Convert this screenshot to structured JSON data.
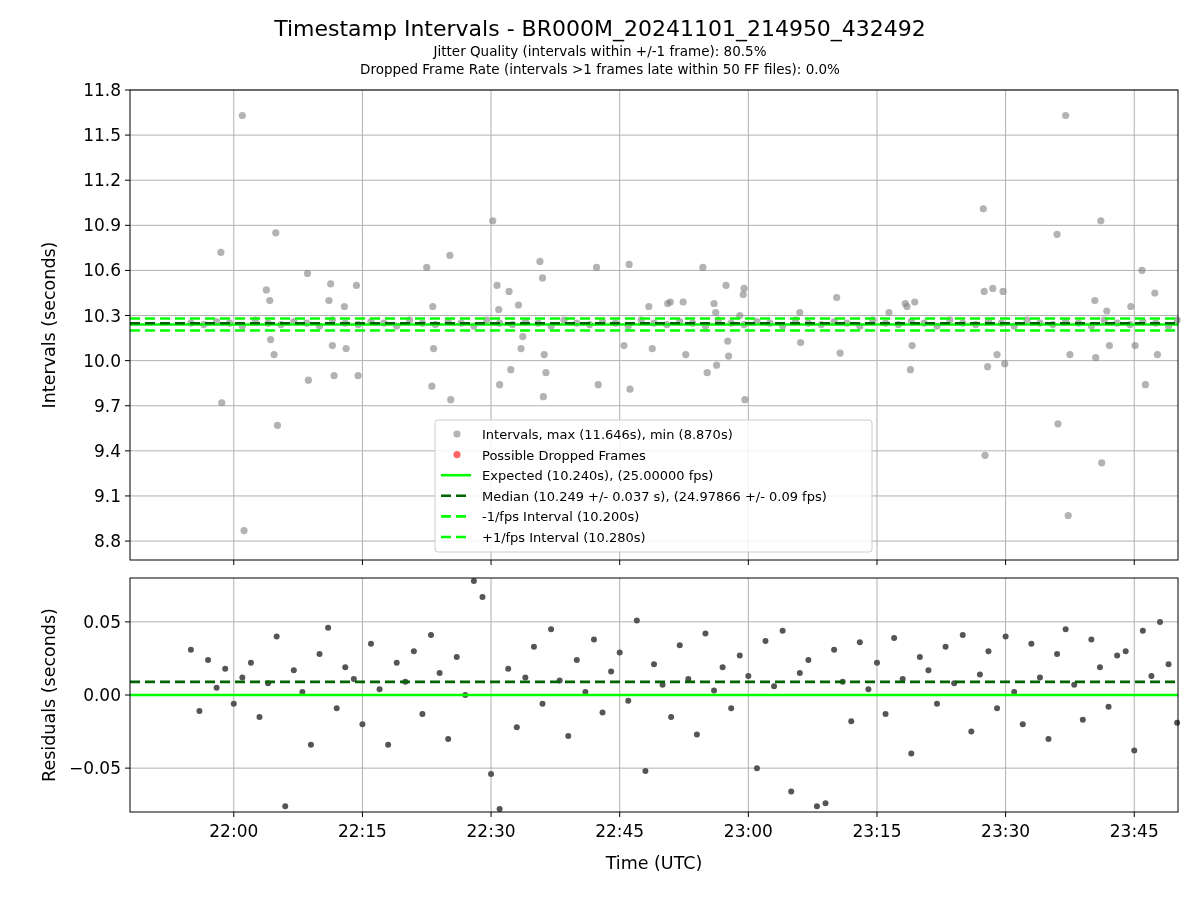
{
  "title": "Timestamp Intervals - BR000M_20241101_214950_432492",
  "subtitles": [
    "Jitter Quality (intervals within +/-1 frame): 80.5%",
    "Dropped Frame Rate (intervals >1 frames late within 50 FF files): 0.0%"
  ],
  "intervals_plot": {
    "chart_data": {
      "type": "scatter",
      "ylabel": "Intervals (seconds)",
      "xlim": [
        1307.9,
        1430.1
      ],
      "ylim": [
        8.674,
        11.8
      ],
      "yticks": [
        {
          "value": 8.8,
          "label": "8.8"
        },
        {
          "value": 9.1,
          "label": "9.1"
        },
        {
          "value": 9.4,
          "label": "9.4"
        },
        {
          "value": 9.7,
          "label": "9.7"
        },
        {
          "value": 10.0,
          "label": "10.0"
        },
        {
          "value": 10.3,
          "label": "10.3"
        },
        {
          "value": 10.6,
          "label": "10.6"
        },
        {
          "value": 10.9,
          "label": "10.9"
        },
        {
          "value": 11.2,
          "label": "11.2"
        },
        {
          "value": 11.5,
          "label": "11.5"
        },
        {
          "value": 11.8,
          "label": "11.8"
        }
      ],
      "series": [
        {
          "name": "Intervals, max (11.646s), min (8.870s)",
          "color": "#808080",
          "x": [
            1318.5,
            1318.6,
            1321.0,
            1321.2,
            1323.8,
            1324.2,
            1324.3,
            1324.7,
            1324.9,
            1325.1,
            1328.6,
            1328.7,
            1331.1,
            1331.3,
            1331.5,
            1331.7,
            1332.9,
            1333.1,
            1334.3,
            1334.5,
            1342.5,
            1343.1,
            1343.2,
            1343.3,
            1345.2,
            1345.3,
            1350.2,
            1350.7,
            1350.9,
            1351.0,
            1352.1,
            1352.3,
            1353.2,
            1353.5,
            1353.7,
            1355.7,
            1356.0,
            1356.1,
            1356.2,
            1356.4,
            1362.3,
            1362.5,
            1365.5,
            1366.1,
            1366.2,
            1368.4,
            1368.8,
            1370.6,
            1370.9,
            1372.4,
            1372.7,
            1374.7,
            1375.2,
            1376.0,
            1376.2,
            1376.3,
            1377.4,
            1377.6,
            1377.7,
            1379.0,
            1379.4,
            1379.5,
            1379.6,
            1386.0,
            1386.1,
            1390.3,
            1390.7,
            1396.4,
            1398.3,
            1398.5,
            1398.9,
            1399.1,
            1399.4,
            1407.4,
            1407.5,
            1407.6,
            1407.9,
            1408.5,
            1409.0,
            1409.7,
            1409.9,
            1416.0,
            1416.1,
            1417.0,
            1417.3,
            1417.5,
            1420.4,
            1420.5,
            1421.1,
            1421.2,
            1421.8,
            1422.1,
            1424.6,
            1425.1,
            1425.9,
            1426.3,
            1427.4,
            1427.7,
            1315,
            1316.5,
            1318,
            1319.5,
            1321,
            1322.5,
            1324,
            1325.5,
            1327,
            1328.5,
            1330,
            1331.5,
            1333,
            1334.5,
            1336,
            1337.5,
            1339,
            1340.5,
            1342,
            1343.5,
            1345,
            1346.5,
            1348,
            1349.5,
            1351,
            1352.5,
            1354,
            1355.5,
            1357,
            1358.5,
            1360,
            1361.5,
            1363,
            1364.5,
            1366,
            1367.5,
            1369,
            1370.5,
            1372,
            1373.5,
            1375,
            1376.5,
            1378,
            1379.5,
            1381,
            1382.5,
            1384,
            1385.5,
            1387,
            1388.5,
            1390,
            1391.5,
            1393,
            1394.5,
            1396,
            1397.5,
            1399,
            1400.5,
            1402,
            1403.5,
            1405,
            1406.5,
            1408,
            1409.5,
            1411,
            1412.5,
            1414,
            1415.5,
            1417,
            1418.5,
            1420,
            1421.5,
            1423,
            1424.5,
            1426,
            1427.5,
            1429,
            1430
          ],
          "values": [
            10.72,
            9.72,
            11.63,
            8.87,
            10.47,
            10.4,
            10.14,
            10.04,
            10.85,
            9.57,
            10.58,
            9.87,
            10.4,
            10.51,
            10.1,
            9.9,
            10.36,
            10.08,
            10.5,
            9.9,
            10.62,
            9.83,
            10.36,
            10.08,
            10.7,
            9.74,
            10.93,
            10.5,
            10.34,
            9.84,
            10.46,
            9.94,
            10.37,
            10.08,
            10.16,
            10.66,
            10.55,
            9.76,
            10.04,
            9.92,
            10.62,
            9.84,
            10.1,
            10.64,
            9.81,
            10.36,
            10.08,
            10.38,
            10.39,
            10.39,
            10.04,
            10.62,
            9.92,
            10.38,
            10.32,
            9.97,
            10.5,
            10.13,
            10.03,
            10.3,
            10.44,
            10.48,
            9.74,
            10.32,
            10.12,
            10.42,
            10.05,
            10.32,
            10.38,
            10.36,
            9.94,
            10.1,
            10.39,
            11.01,
            10.46,
            9.37,
            9.96,
            10.48,
            10.04,
            10.46,
            9.98,
            10.84,
            9.58,
            11.63,
            8.97,
            10.04,
            10.4,
            10.02,
            10.93,
            9.32,
            10.33,
            10.1,
            10.36,
            10.1,
            10.6,
            9.84,
            10.45,
            10.04,
            10.25,
            10.24,
            10.26,
            10.25,
            10.23,
            10.27,
            10.25,
            10.24,
            10.26,
            10.25,
            10.23,
            10.27,
            10.25,
            10.24,
            10.26,
            10.25,
            10.23,
            10.27,
            10.25,
            10.24,
            10.26,
            10.25,
            10.23,
            10.27,
            10.25,
            10.24,
            10.26,
            10.25,
            10.23,
            10.27,
            10.25,
            10.24,
            10.26,
            10.25,
            10.23,
            10.27,
            10.25,
            10.24,
            10.26,
            10.25,
            10.23,
            10.27,
            10.25,
            10.24,
            10.26,
            10.25,
            10.23,
            10.27,
            10.25,
            10.24,
            10.26,
            10.25,
            10.23,
            10.27,
            10.25,
            10.24,
            10.26,
            10.25,
            10.23,
            10.27,
            10.25,
            10.24,
            10.26,
            10.25,
            10.23,
            10.27,
            10.25,
            10.24,
            10.26,
            10.25,
            10.23,
            10.27,
            10.25,
            10.24,
            10.26,
            10.25,
            10.23,
            10.27
          ]
        },
        {
          "name": "Possible Dropped Frames",
          "color": "#ff0000"
        },
        {
          "type": "line",
          "line_style": "solid",
          "name": "Expected (10.240s), (25.00000 fps)",
          "color": "#00ff00",
          "x": [
            1307.9,
            1430.1
          ],
          "values": [
            10.24,
            10.24
          ]
        },
        {
          "type": "line",
          "line_style": "dashed",
          "name": "Median (10.249 +/- 0.037 s), (24.97866 +/- 0.09 fps)",
          "color": "#006400",
          "x": [
            1307.9,
            1430.1
          ],
          "values": [
            10.249,
            10.249
          ]
        },
        {
          "type": "line",
          "line_style": "dashed",
          "name": "-1/fps Interval (10.200s)",
          "color": "#00ff00",
          "x": [
            1307.9,
            1430.1
          ],
          "values": [
            10.2,
            10.2
          ]
        },
        {
          "type": "line",
          "line_style": "dashed",
          "name": "+1/fps Interval (10.280s)",
          "color": "#00ff00",
          "x": [
            1307.9,
            1430.1
          ],
          "values": [
            10.28,
            10.28
          ]
        }
      ],
      "grid": true,
      "legend": "lower center"
    }
  },
  "residuals_plot": {
    "chart_data": {
      "type": "scatter",
      "xlabel": "Time (UTC)",
      "ylabel": "Residuals (seconds)",
      "xlim": [
        1307.9,
        1430.1
      ],
      "ylim": [
        -0.08,
        0.08
      ],
      "xticks": [
        {
          "value": 1320,
          "label": "22:00"
        },
        {
          "value": 1335,
          "label": "22:15"
        },
        {
          "value": 1350,
          "label": "22:30"
        },
        {
          "value": 1365,
          "label": "22:45"
        },
        {
          "value": 1380,
          "label": "23:00"
        },
        {
          "value": 1395,
          "label": "23:15"
        },
        {
          "value": 1410,
          "label": "23:30"
        },
        {
          "value": 1425,
          "label": "23:45"
        }
      ],
      "yticks": [
        {
          "value": -0.05,
          "label": "−0.05"
        },
        {
          "value": 0,
          "label": "0.00"
        },
        {
          "value": 0.05,
          "label": "0.05"
        }
      ],
      "series": [
        {
          "color": "#555555",
          "x": [
            1315,
            1316,
            1317,
            1318,
            1319,
            1320,
            1321,
            1322,
            1323,
            1324,
            1325,
            1326,
            1327,
            1328,
            1329,
            1330,
            1331,
            1332,
            1333,
            1334,
            1335,
            1336,
            1337,
            1338,
            1339,
            1340,
            1341,
            1342,
            1343,
            1344,
            1345,
            1346,
            1347,
            1348,
            1349,
            1350,
            1351,
            1352,
            1353,
            1354,
            1355,
            1356,
            1357,
            1358,
            1359,
            1360,
            1361,
            1362,
            1363,
            1364,
            1365,
            1366,
            1367,
            1368,
            1369,
            1370,
            1371,
            1372,
            1373,
            1374,
            1375,
            1376,
            1377,
            1378,
            1379,
            1380,
            1381,
            1382,
            1383,
            1384,
            1385,
            1386,
            1387,
            1388,
            1389,
            1390,
            1391,
            1392,
            1393,
            1394,
            1395,
            1396,
            1397,
            1398,
            1399,
            1400,
            1401,
            1402,
            1403,
            1404,
            1405,
            1406,
            1407,
            1408,
            1409,
            1410,
            1411,
            1412,
            1413,
            1414,
            1415,
            1416,
            1417,
            1418,
            1419,
            1420,
            1421,
            1422,
            1423,
            1424,
            1425,
            1426,
            1427,
            1428,
            1429,
            1430
          ],
          "values": [
            0.031,
            -0.011,
            0.024,
            0.005,
            0.018,
            -0.006,
            0.012,
            0.022,
            -0.015,
            0.008,
            0.04,
            -0.076,
            0.017,
            0.002,
            -0.034,
            0.028,
            0.046,
            -0.009,
            0.019,
            0.011,
            -0.02,
            0.035,
            0.004,
            -0.034,
            0.022,
            0.009,
            0.03,
            -0.013,
            0.041,
            0.015,
            -0.03,
            0.026,
            0.0,
            0.078,
            0.067,
            -0.054,
            -0.078,
            0.018,
            -0.022,
            0.012,
            0.033,
            -0.006,
            0.045,
            0.01,
            -0.028,
            0.024,
            0.002,
            0.038,
            -0.012,
            0.016,
            0.029,
            -0.004,
            0.051,
            -0.052,
            0.021,
            0.007,
            -0.015,
            0.034,
            0.011,
            -0.027,
            0.042,
            0.003,
            0.019,
            -0.009,
            0.027,
            0.013,
            -0.05,
            0.037,
            0.006,
            0.044,
            -0.066,
            0.015,
            0.024,
            -0.076,
            -0.074,
            0.031,
            0.009,
            -0.018,
            0.036,
            0.004,
            0.022,
            -0.013,
            0.039,
            0.011,
            -0.04,
            0.026,
            0.017,
            -0.006,
            0.033,
            0.008,
            0.041,
            -0.025,
            0.014,
            0.03,
            -0.009,
            0.04,
            0.002,
            -0.02,
            0.035,
            0.012,
            -0.03,
            0.028,
            0.045,
            0.007,
            -0.017,
            0.038,
            0.019,
            -0.008,
            0.027,
            0.03,
            -0.038,
            0.044,
            0.013,
            0.05,
            0.021,
            -0.019
          ]
        },
        {
          "type": "line",
          "line_style": "solid",
          "color": "#00ff00",
          "x": [
            1307.9,
            1430.1
          ],
          "values": [
            0,
            0
          ]
        },
        {
          "type": "line",
          "line_style": "dashed",
          "color": "#006400",
          "x": [
            1307.9,
            1430.1
          ],
          "values": [
            0.009,
            0.009
          ]
        }
      ],
      "grid": true
    }
  }
}
